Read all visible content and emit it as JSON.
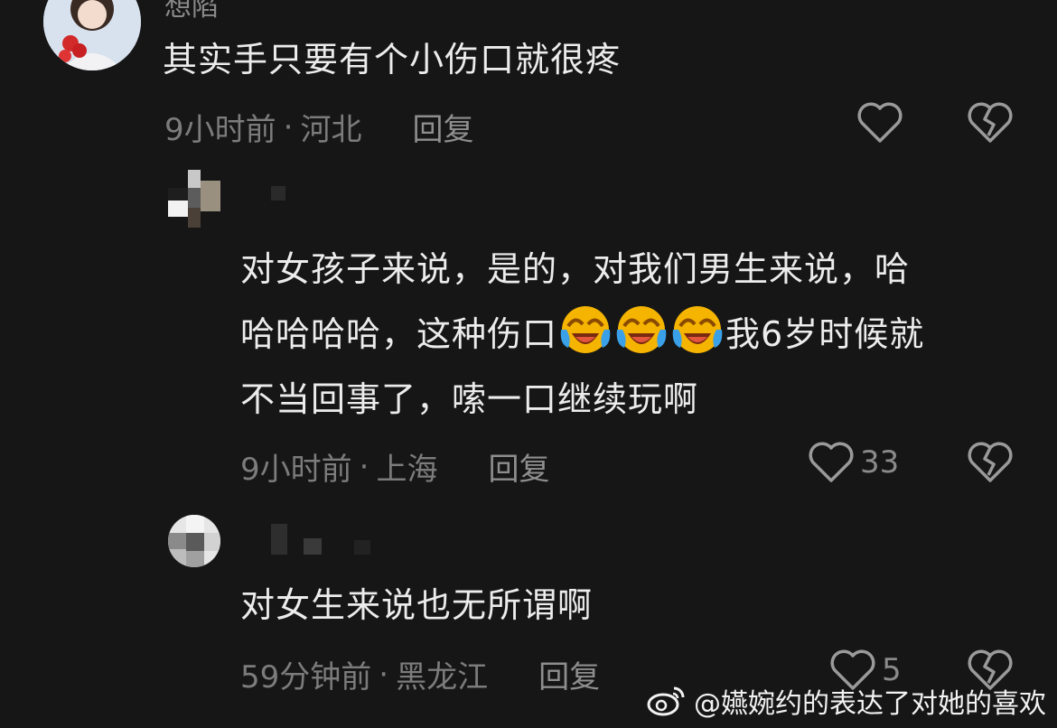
{
  "comments": [
    {
      "username": "想陷",
      "text": "其实手只要有个小伤口就很疼",
      "time": "9小时前",
      "location": "河北",
      "reply_label": "回复",
      "likes": ""
    },
    {
      "username": "",
      "text_line1": "对女孩子来说，是的，对我们男生来说，哈",
      "text_line2a": "哈哈哈哈，这种伤口",
      "text_line2b": "我6岁时候就",
      "text_line3": "不当回事了，嗦一口继续玩啊",
      "emoji_name": "crying-laughing-emoji",
      "time": "9小时前",
      "location": "上海",
      "reply_label": "回复",
      "likes": "33"
    },
    {
      "username": "",
      "text": "对女生来说也无所谓啊",
      "time": "59分钟前",
      "location": "黑龙江",
      "reply_label": "回复",
      "likes": "5"
    }
  ],
  "separator": "·",
  "icons": {
    "like": "heart-outline-icon",
    "dislike": "broken-heart-icon",
    "watermark_logo": "weibo-logo-icon"
  },
  "watermark": "@嬿婉约的表达了对她的喜欢",
  "colors": {
    "background": "#161616",
    "text": "#ececec",
    "meta": "#7c7c7c"
  }
}
